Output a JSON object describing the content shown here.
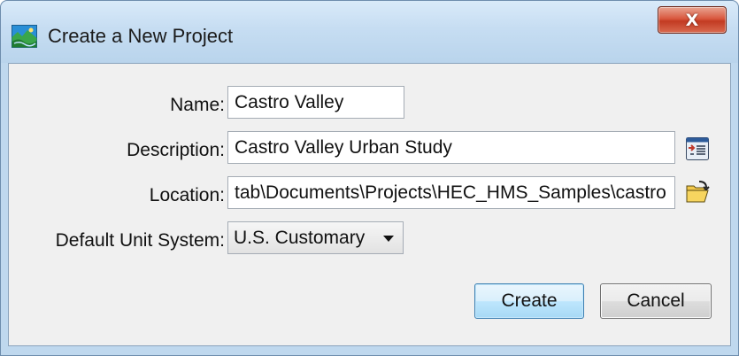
{
  "window": {
    "title": "Create a New Project",
    "close_glyph": "X",
    "app_icon": "hec-hms-landscape-icon"
  },
  "form": {
    "name": {
      "label": "Name:",
      "value": "Castro Valley"
    },
    "description": {
      "label": "Description:",
      "value": "Castro Valley Urban Study",
      "button_icon": "description-editor-icon"
    },
    "location": {
      "label": "Location:",
      "value": "tab\\Documents\\Projects\\HEC_HMS_Samples\\castro",
      "button_icon": "open-folder-icon"
    },
    "unit_system": {
      "label": "Default Unit System:",
      "selected": "U.S. Customary"
    }
  },
  "buttons": {
    "create": "Create",
    "cancel": "Cancel"
  },
  "colors": {
    "title_bar": "#c6ddf2",
    "close_button": "#c23a22",
    "dialog_bg": "#f0f0f0",
    "default_button": "#bee6fd"
  }
}
